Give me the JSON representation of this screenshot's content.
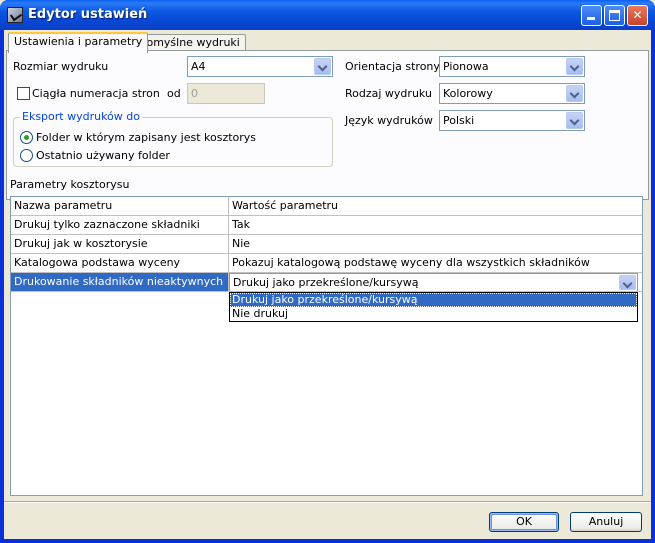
{
  "window": {
    "title": "Edytor ustawień"
  },
  "tabs": [
    {
      "label": "Ustawienia i parametry",
      "active": true
    },
    {
      "label": "Domyślne wydruki",
      "active": false
    }
  ],
  "settings": {
    "page_size_label": "Rozmiar wydruku",
    "page_size_value": "A4",
    "continuous_numbering_label": "Ciągła numeracja stron",
    "continuous_numbering_checked": false,
    "from_label": "od",
    "from_value": "0",
    "orientation_label": "Orientacja strony",
    "orientation_value": "Pionowa",
    "print_type_label": "Rodzaj wydruku",
    "print_type_value": "Kolorowy",
    "language_label": "Język wydruków",
    "language_value": "Polski",
    "export": {
      "legend": "Eksport wydruków do",
      "option1": "Folder w którym zapisany jest kosztorys",
      "option2": "Ostatnio używany folder",
      "selected": 1
    }
  },
  "params": {
    "section_label": "Parametry kosztorysu",
    "col_name": "Nazwa parametru",
    "col_value": "Wartość parametru",
    "rows": [
      {
        "name": "Drukuj tylko zaznaczone składniki",
        "value": "Tak"
      },
      {
        "name": "Drukuj jak w kosztorysie",
        "value": "Nie"
      },
      {
        "name": "Katalogowa podstawa wyceny",
        "value": "Pokazuj katalogową podstawę wyceny dla wszystkich składników"
      },
      {
        "name": "Drukowanie składników nieaktywnych",
        "value": "Drukuj jako przekreślone/kursywą"
      }
    ],
    "dropdown_options": [
      "Drukuj jako przekreślone/kursywą",
      "Nie drukuj"
    ],
    "dropdown_highlighted": 0
  },
  "buttons": {
    "ok": "OK",
    "cancel": "Anuluj"
  }
}
